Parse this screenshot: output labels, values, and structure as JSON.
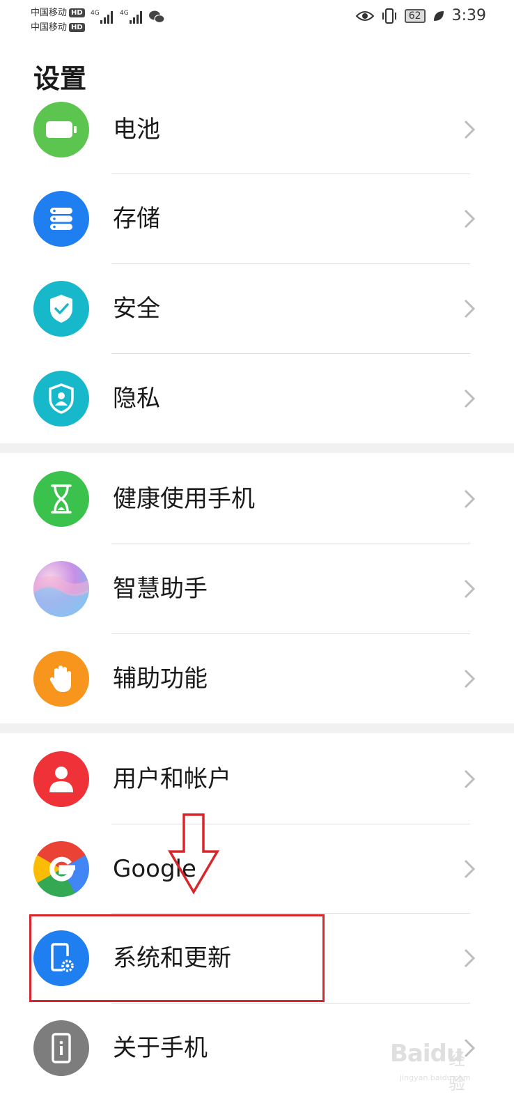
{
  "status_bar": {
    "carrier1": "中国移动",
    "carrier2": "中国移动",
    "hd_badge": "HD",
    "net1": "4G",
    "net2": "4G",
    "battery_level": "62",
    "time": "3:39"
  },
  "page_title": "设置",
  "groups": [
    [
      {
        "label": "电池",
        "icon": "battery-icon",
        "color": "#5bc550"
      },
      {
        "label": "存储",
        "icon": "storage-icon",
        "color": "#1f7ff0"
      },
      {
        "label": "安全",
        "icon": "security-shield-icon",
        "color": "#16b8c9"
      },
      {
        "label": "隐私",
        "icon": "privacy-icon",
        "color": "#16b8c9"
      }
    ],
    [
      {
        "label": "健康使用手机",
        "icon": "hourglass-icon",
        "color": "#3bc24d"
      },
      {
        "label": "智慧助手",
        "icon": "smart-assistant-icon",
        "color": "#c890e6"
      },
      {
        "label": "辅助功能",
        "icon": "hand-icon",
        "color": "#f7951d"
      }
    ],
    [
      {
        "label": "用户和帐户",
        "icon": "user-icon",
        "color": "#ef3237"
      },
      {
        "label": "Google",
        "icon": "google-icon",
        "color": "#4285f4"
      },
      {
        "label": "系统和更新",
        "icon": "phone-settings-icon",
        "color": "#1f7ff0"
      },
      {
        "label": "关于手机",
        "icon": "about-phone-icon",
        "color": "#7d7d7d"
      }
    ]
  ],
  "watermark": {
    "brand": "Baidu",
    "brand_cn": "经验",
    "url": "jingyan.baidu.com"
  },
  "annotation_color": "#d9262c"
}
